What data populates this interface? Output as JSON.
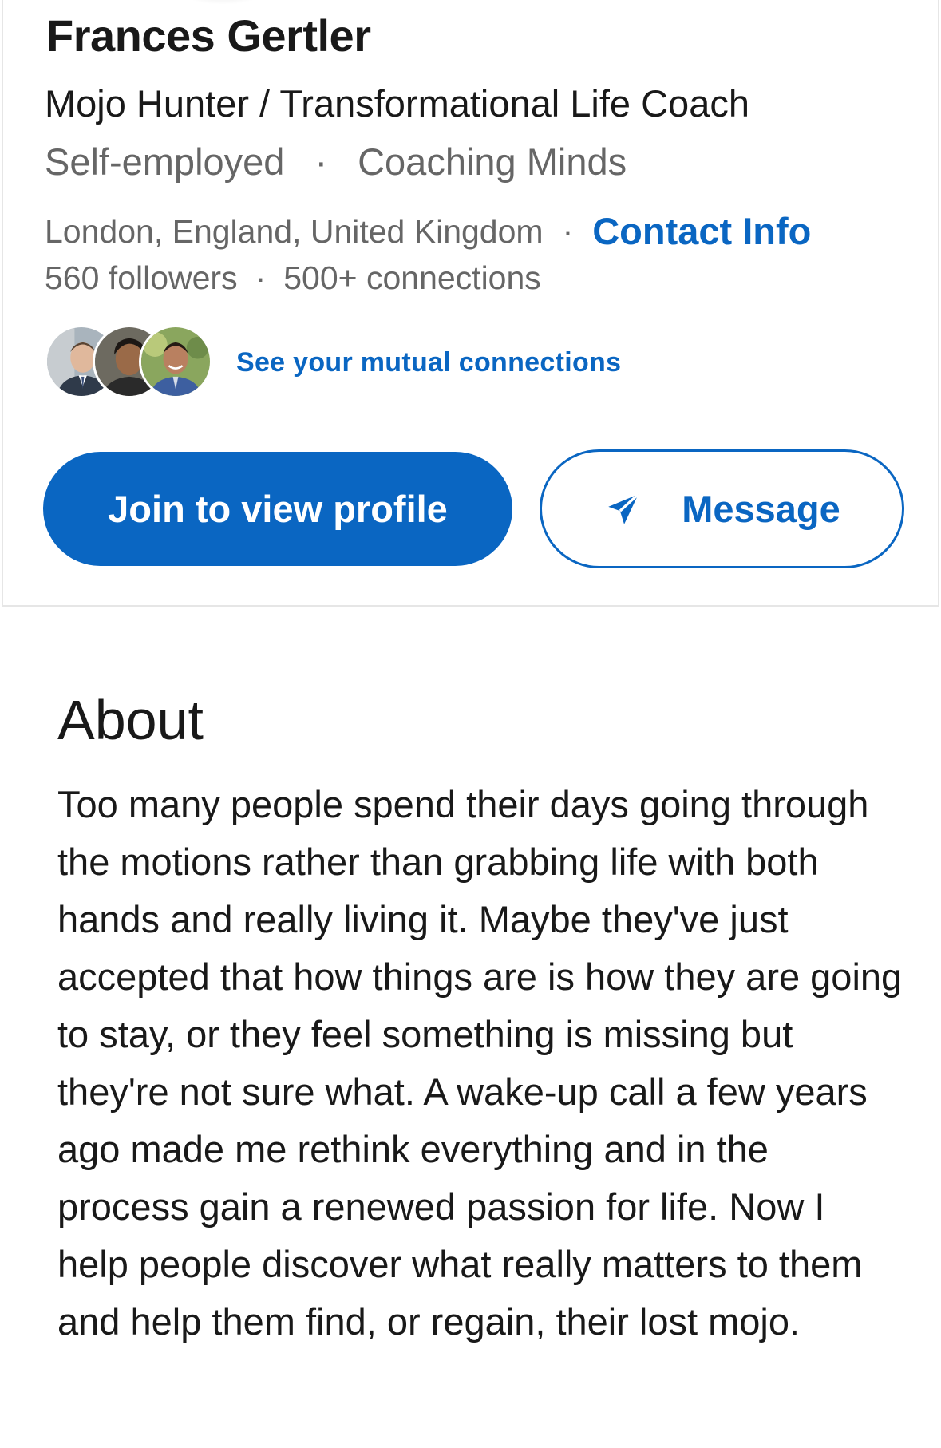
{
  "profile": {
    "name": "Frances Gertler",
    "headline": "Mojo Hunter / Transformational Life Coach",
    "employment": "Self-employed",
    "company": "Coaching Minds",
    "location": "London, England, United Kingdom",
    "contact_info_label": "Contact Info",
    "followers": "560 followers",
    "connections": "500+ connections",
    "separator": "·"
  },
  "mutual": {
    "label": "See your mutual connections",
    "avatars": [
      "avatar-1",
      "avatar-2",
      "avatar-3"
    ]
  },
  "actions": {
    "join_label": "Join to view profile",
    "message_label": "Message",
    "message_icon": "send-icon"
  },
  "about": {
    "title": "About",
    "text": "Too many people spend their days going through the motions rather than grabbing life with both hands and really living it. Maybe they've just accepted that how things are is how they are going to stay, or they feel something is missing but they're not sure what. A wake-up call a few years ago made me rethink everything and in the process gain a renewed passion for life. Now I help people discover what really matters to them and help them find, or regain, their lost mojo."
  },
  "colors": {
    "brand_blue": "#0a66c2",
    "text_primary": "#191919",
    "text_secondary": "#666666"
  }
}
